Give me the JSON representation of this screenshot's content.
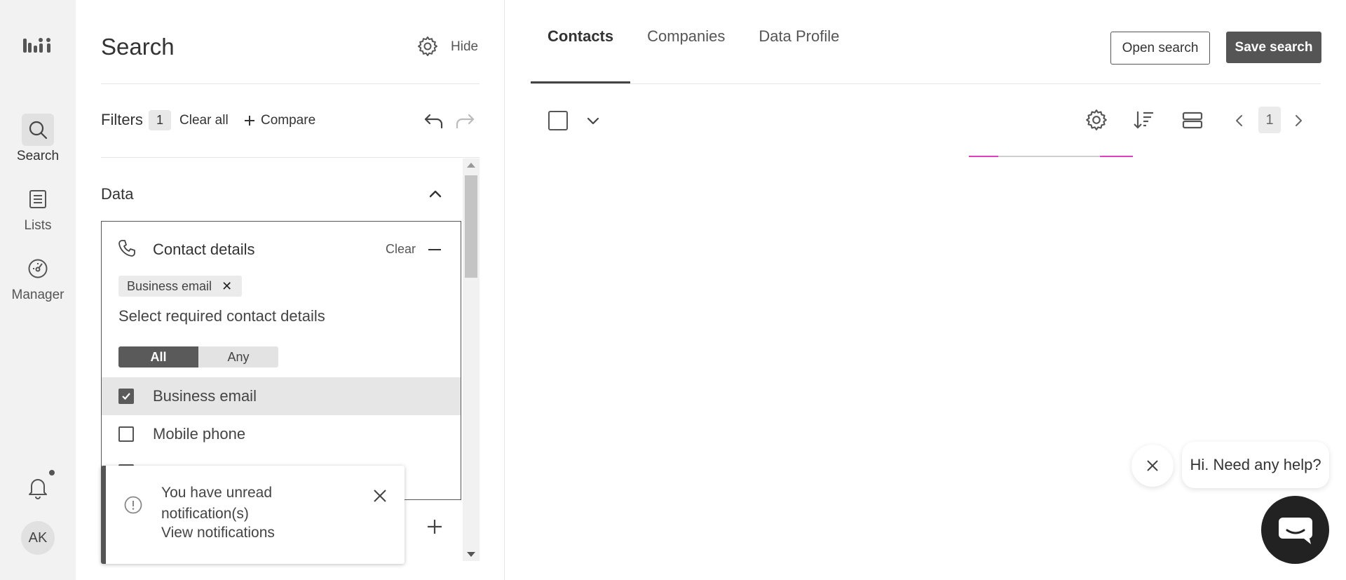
{
  "rail": {
    "items": [
      {
        "label": "Search",
        "icon": "search-icon",
        "active": true
      },
      {
        "label": "Lists",
        "icon": "list-icon",
        "active": false
      },
      {
        "label": "Manager",
        "icon": "dashboard-icon",
        "active": false
      }
    ],
    "avatar_initials": "AK"
  },
  "panel": {
    "title": "Search",
    "hide_label": "Hide",
    "filters_label": "Filters",
    "filters_count": "1",
    "clear_all": "Clear all",
    "compare": "Compare",
    "data_section": "Data",
    "contact_details": {
      "title": "Contact details",
      "clear": "Clear",
      "chip": "Business email",
      "select_prompt": "Select required contact details",
      "segment": [
        "All",
        "Any"
      ],
      "segment_selected": "All",
      "options": [
        {
          "label": "Business email",
          "checked": true
        },
        {
          "label": "Mobile phone",
          "checked": false
        }
      ]
    }
  },
  "toast": {
    "message": "You have unread notification(s)",
    "link": "View notifications"
  },
  "main": {
    "tabs": [
      "Contacts",
      "Companies",
      "Data Profile"
    ],
    "active_tab": "Contacts",
    "open_search": "Open search",
    "save_search": "Save search",
    "page": "1"
  },
  "chat": {
    "greeting": "Hi. Need any help?"
  },
  "colors": {
    "rail_bg": "#f2f2f2",
    "accent_dark": "#555555",
    "progress_accent": "#e040c0"
  }
}
